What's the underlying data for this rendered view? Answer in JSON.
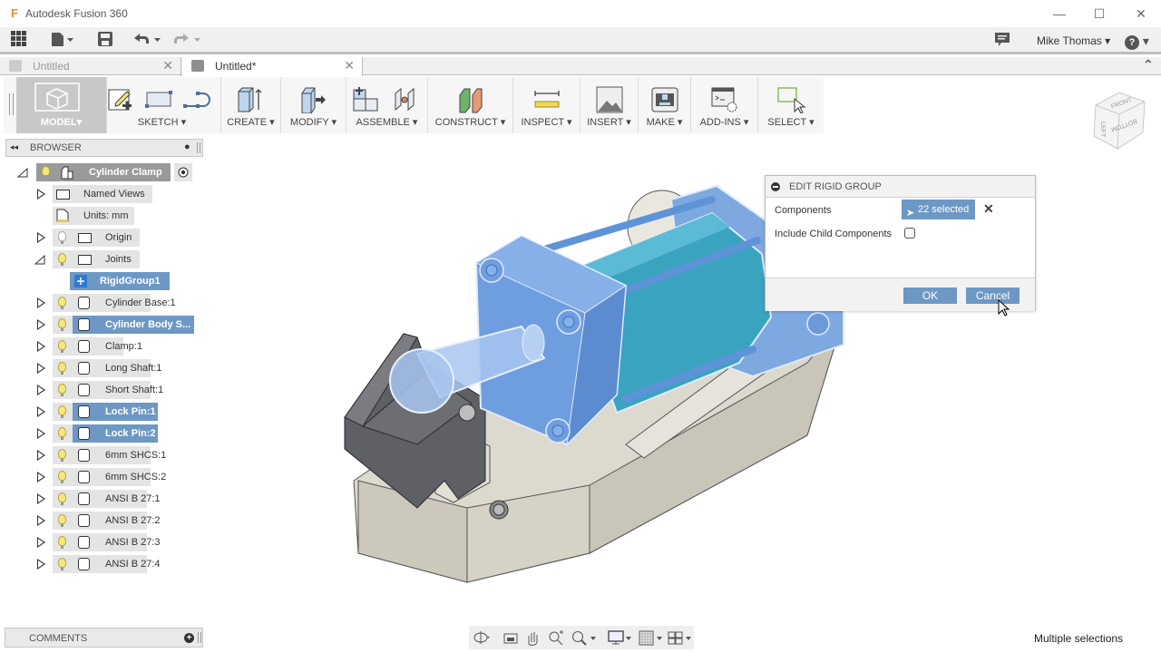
{
  "app": {
    "title": "Autodesk Fusion 360",
    "logo_icon": "fusion-logo-icon"
  },
  "window_controls": {
    "minimize": "—",
    "maximize": "☐",
    "close": "✕"
  },
  "quick_access": {
    "grid_icon": "▦",
    "file_icon": "▙",
    "save_icon": "💾",
    "undo_icon": "↶",
    "redo_icon": "↷",
    "dropdown": "▾",
    "comments_icon": "▤",
    "user_name": "Mike Thomas",
    "help_icon": "?"
  },
  "tabs": [
    {
      "label": "Untitled",
      "active": false,
      "close": "✕"
    },
    {
      "label": "Untitled*",
      "active": true,
      "close": "✕"
    }
  ],
  "tabs_collapse_icon": "⌃",
  "toolbar": {
    "workspace": "MODEL",
    "groups": [
      {
        "label": "SKETCH"
      },
      {
        "label": "CREATE"
      },
      {
        "label": "MODIFY"
      },
      {
        "label": "ASSEMBLE"
      },
      {
        "label": "CONSTRUCT"
      },
      {
        "label": "INSPECT"
      },
      {
        "label": "INSERT"
      },
      {
        "label": "MAKE"
      },
      {
        "label": "ADD-INS"
      },
      {
        "label": "SELECT"
      }
    ],
    "dropdown_arrow": "▾"
  },
  "browser": {
    "title": "BROWSER",
    "collapse_icon": "◂◂",
    "pin_icon": "●",
    "root": {
      "label": "Cylinder Clamp"
    },
    "items": [
      {
        "label": "Named Views",
        "type": "folder",
        "expandable": true
      },
      {
        "label": "Units: mm",
        "type": "units",
        "expandable": false
      },
      {
        "label": "Origin",
        "type": "folder",
        "expandable": true,
        "visible": false
      },
      {
        "label": "Joints",
        "type": "folder",
        "expandable": true,
        "expanded": true
      },
      {
        "label": "RigidGroup1",
        "type": "rigidgroup",
        "selected": true
      },
      {
        "label": "Cylinder Base:1",
        "type": "component"
      },
      {
        "label": "Cylinder Body S...",
        "type": "component",
        "selected": true
      },
      {
        "label": "Clamp:1",
        "type": "component"
      },
      {
        "label": "Long Shaft:1",
        "type": "component"
      },
      {
        "label": "Short Shaft:1",
        "type": "component"
      },
      {
        "label": "Lock Pin:1",
        "type": "component",
        "selected": true
      },
      {
        "label": "Lock Pin:2",
        "type": "component",
        "selected": true
      },
      {
        "label": "6mm SHCS:1",
        "type": "component"
      },
      {
        "label": "6mm SHCS:2",
        "type": "component"
      },
      {
        "label": "ANSI B 27:1",
        "type": "component"
      },
      {
        "label": "ANSI B 27:2",
        "type": "component"
      },
      {
        "label": "ANSI B 27:3",
        "type": "component"
      },
      {
        "label": "ANSI B 27:4",
        "type": "component"
      }
    ]
  },
  "dialog": {
    "title": "EDIT RIGID GROUP",
    "components_label": "Components",
    "components_value": "22 selected",
    "clear_icon": "✕",
    "include_child_label": "Include Child Components",
    "include_child_checked": false,
    "ok_label": "OK",
    "cancel_label": "Cancel"
  },
  "viewcube": {
    "faces": [
      "FRONT",
      "LEFT",
      "BOTTOM"
    ]
  },
  "comments": {
    "title": "COMMENTS",
    "add_icon": "+"
  },
  "navbar": {
    "icons": [
      "orbit-icon",
      "look-at-icon",
      "pan-icon",
      "zoom-window-icon",
      "zoom-icon",
      "display-settings-icon",
      "grid-settings-icon",
      "viewports-icon"
    ]
  },
  "status": {
    "text": "Multiple selections"
  },
  "colors": {
    "selection_blue": "#6e98c4",
    "toolbar_bg": "#f6f6f6",
    "model_tab_bg": "#c8c8c8"
  }
}
